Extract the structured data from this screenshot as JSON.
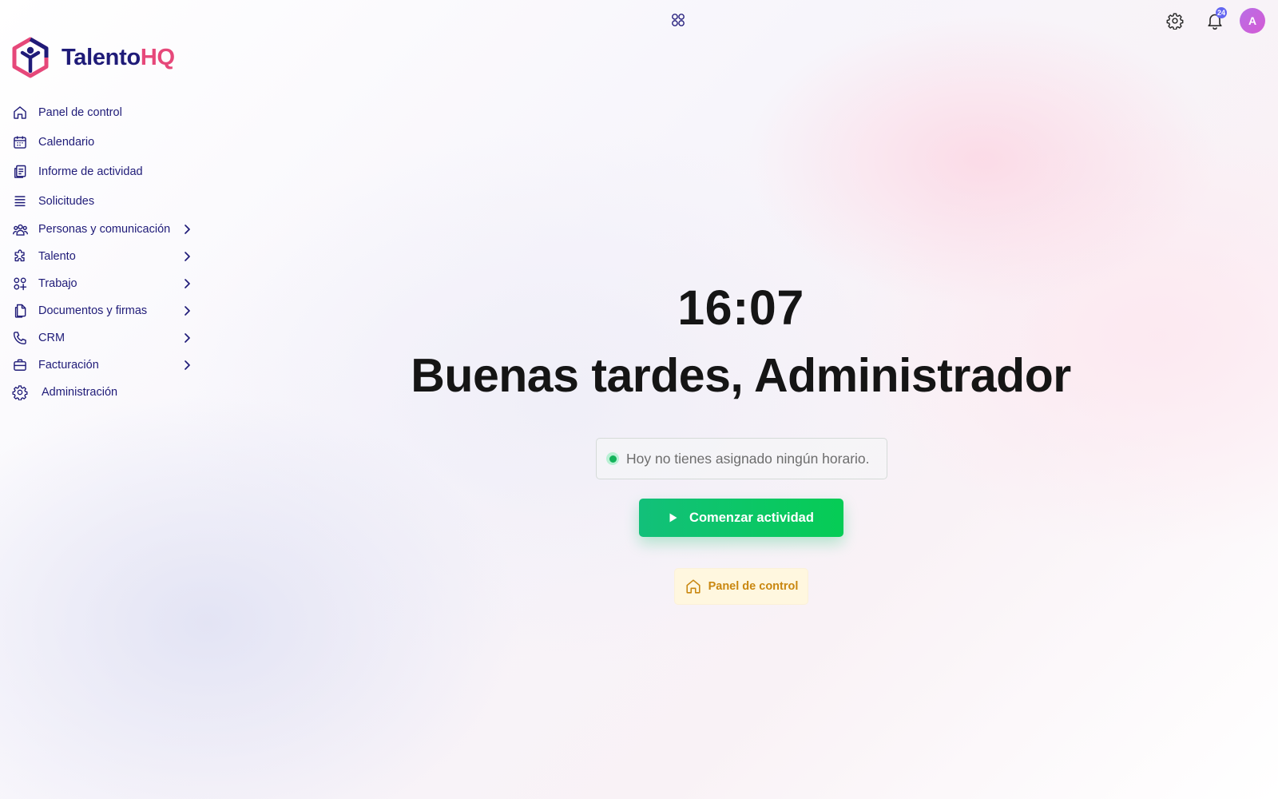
{
  "brand": {
    "name_part1": "Talento",
    "name_part2": "HQ"
  },
  "header": {
    "notification_count": "24",
    "avatar_initial": "A"
  },
  "sidebar": {
    "items": [
      {
        "label": "Panel de control",
        "icon": "home-icon",
        "has_submenu": false
      },
      {
        "label": "Calendario",
        "icon": "calendar-icon",
        "has_submenu": false
      },
      {
        "label": "Informe de actividad",
        "icon": "report-icon",
        "has_submenu": false
      },
      {
        "label": "Solicitudes",
        "icon": "list-icon",
        "has_submenu": false
      },
      {
        "label": "Personas y comunicación",
        "icon": "people-icon",
        "has_submenu": true
      },
      {
        "label": "Talento",
        "icon": "puzzle-icon",
        "has_submenu": true
      },
      {
        "label": "Trabajo",
        "icon": "apps-icon",
        "has_submenu": true
      },
      {
        "label": "Documentos y firmas",
        "icon": "documents-icon",
        "has_submenu": true
      },
      {
        "label": "CRM",
        "icon": "phone-icon",
        "has_submenu": true
      },
      {
        "label": "Facturación",
        "icon": "briefcase-icon",
        "has_submenu": true
      },
      {
        "label": "Administración",
        "icon": "gear-icon",
        "has_submenu": false
      }
    ]
  },
  "main": {
    "time": "16:07",
    "greeting": "Buenas tardes, Administrador",
    "schedule_status": "Hoy no tienes asignado ningún horario.",
    "start_button": "Comenzar actividad",
    "dashboard_button": "Panel de control"
  },
  "colors": {
    "primary": "#1f1b78",
    "brand_pink": "#e6487a",
    "success": "#06cc55",
    "warning": "#c98710",
    "badge": "#6366f1"
  }
}
